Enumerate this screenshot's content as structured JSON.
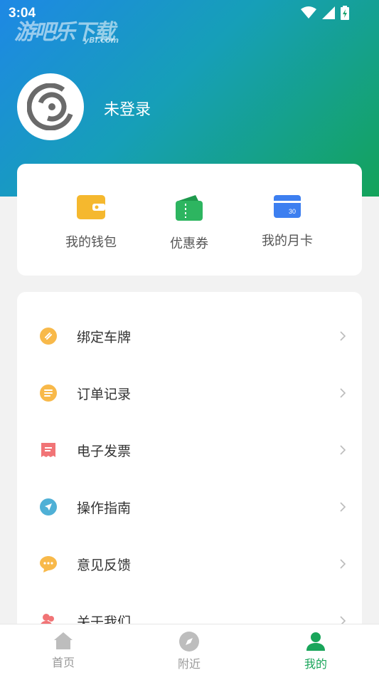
{
  "status_bar": {
    "time": "3:04"
  },
  "watermark": {
    "main": "游吧乐下载",
    "sub": "yBl.com"
  },
  "profile": {
    "login_status": "未登录"
  },
  "wallet": {
    "items": [
      {
        "label": "我的钱包",
        "icon": "wallet-icon",
        "color": "#f5b82e"
      },
      {
        "label": "优惠券",
        "icon": "coupon-icon",
        "color": "#2db560"
      },
      {
        "label": "我的月卡",
        "icon": "monthly-card-icon",
        "color": "#3d7ff0"
      }
    ]
  },
  "menu": {
    "items": [
      {
        "label": "绑定车牌",
        "icon": "link-icon",
        "color": "#f8b94a"
      },
      {
        "label": "订单记录",
        "icon": "list-icon",
        "color": "#f8b94a"
      },
      {
        "label": "电子发票",
        "icon": "receipt-icon",
        "color": "#f17476"
      },
      {
        "label": "操作指南",
        "icon": "navigate-icon",
        "color": "#4fb0d6"
      },
      {
        "label": "意见反馈",
        "icon": "chat-icon",
        "color": "#f8b94a"
      },
      {
        "label": "关于我们",
        "icon": "people-icon",
        "color": "#f17476"
      }
    ]
  },
  "tabbar": {
    "tabs": [
      {
        "label": "首页",
        "icon": "home-icon",
        "active": false
      },
      {
        "label": "附近",
        "icon": "compass-icon",
        "active": false
      },
      {
        "label": "我的",
        "icon": "user-icon",
        "active": true
      }
    ],
    "active_color": "#19a55a",
    "inactive_color": "#999999"
  }
}
